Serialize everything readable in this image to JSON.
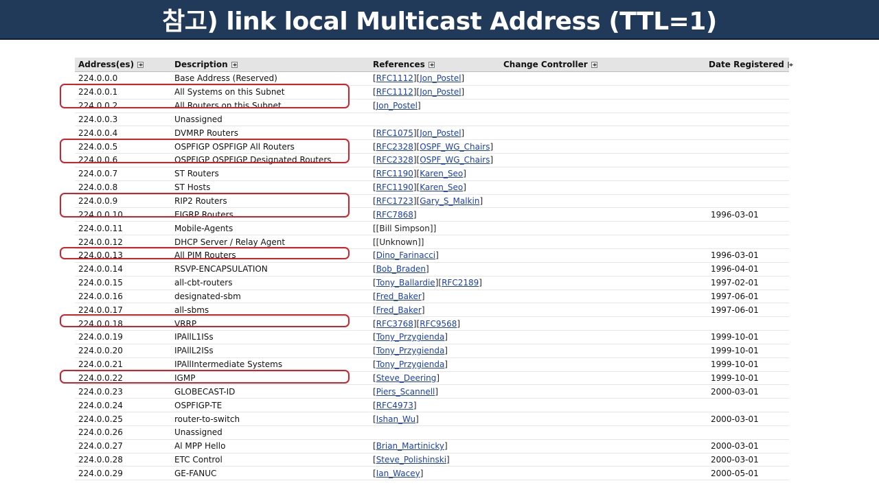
{
  "banner": {
    "title": "참고) link local Multicast Address (TTL=1)"
  },
  "table": {
    "headers": {
      "address": "Address(es)",
      "description": "Description",
      "references": "References",
      "change_controller": "Change Controller",
      "date_registered": "Date Registered"
    },
    "rows": [
      {
        "address": "224.0.0.0",
        "description": "Base Address (Reserved)",
        "refs": [
          {
            "t": "RFC1112",
            "link": true
          },
          {
            "t": "Jon_Postel",
            "link": true
          }
        ],
        "date": ""
      },
      {
        "address": "224.0.0.1",
        "description": "All Systems on this Subnet",
        "refs": [
          {
            "t": "RFC1112",
            "link": true
          },
          {
            "t": "Jon_Postel",
            "link": true
          }
        ],
        "date": ""
      },
      {
        "address": "224.0.0.2",
        "description": "All Routers on this Subnet",
        "refs": [
          {
            "t": "Jon_Postel",
            "link": true
          }
        ],
        "date": ""
      },
      {
        "address": "224.0.0.3",
        "description": "Unassigned",
        "refs": [],
        "date": ""
      },
      {
        "address": "224.0.0.4",
        "description": "DVMRP Routers",
        "refs": [
          {
            "t": "RFC1075",
            "link": true
          },
          {
            "t": "Jon_Postel",
            "link": true
          }
        ],
        "date": ""
      },
      {
        "address": "224.0.0.5",
        "description": "OSPFIGP OSPFIGP All Routers",
        "refs": [
          {
            "t": "RFC2328",
            "link": true
          },
          {
            "t": "OSPF_WG_Chairs",
            "link": true
          }
        ],
        "date": ""
      },
      {
        "address": "224.0.0.6",
        "description": "OSPFIGP OSPFIGP Designated Routers",
        "refs": [
          {
            "t": "RFC2328",
            "link": true
          },
          {
            "t": "OSPF_WG_Chairs",
            "link": true
          }
        ],
        "date": ""
      },
      {
        "address": "224.0.0.7",
        "description": "ST Routers",
        "refs": [
          {
            "t": "RFC1190",
            "link": true
          },
          {
            "t": "Karen_Seo",
            "link": true
          }
        ],
        "date": ""
      },
      {
        "address": "224.0.0.8",
        "description": "ST Hosts",
        "refs": [
          {
            "t": "RFC1190",
            "link": true
          },
          {
            "t": "Karen_Seo",
            "link": true
          }
        ],
        "date": ""
      },
      {
        "address": "224.0.0.9",
        "description": "RIP2 Routers",
        "refs": [
          {
            "t": "RFC1723",
            "link": true
          },
          {
            "t": "Gary_S_Malkin",
            "link": true
          }
        ],
        "date": ""
      },
      {
        "address": "224.0.0.10",
        "description": "EIGRP Routers",
        "refs": [
          {
            "t": "RFC7868",
            "link": true
          }
        ],
        "date": "1996-03-01"
      },
      {
        "address": "224.0.0.11",
        "description": "Mobile-Agents",
        "refs": [
          {
            "t": "Bill Simpson",
            "link": false
          }
        ],
        "date": ""
      },
      {
        "address": "224.0.0.12",
        "description": "DHCP Server / Relay Agent",
        "refs": [
          {
            "t": "Unknown",
            "link": false
          }
        ],
        "date": ""
      },
      {
        "address": "224.0.0.13",
        "description": "All PIM Routers",
        "refs": [
          {
            "t": "Dino_Farinacci",
            "link": true
          }
        ],
        "date": "1996-03-01"
      },
      {
        "address": "224.0.0.14",
        "description": "RSVP-ENCAPSULATION",
        "refs": [
          {
            "t": "Bob_Braden",
            "link": true
          }
        ],
        "date": "1996-04-01"
      },
      {
        "address": "224.0.0.15",
        "description": "all-cbt-routers",
        "refs": [
          {
            "t": "Tony_Ballardie",
            "link": true
          },
          {
            "t": "RFC2189",
            "link": true
          }
        ],
        "date": "1997-02-01"
      },
      {
        "address": "224.0.0.16",
        "description": "designated-sbm",
        "refs": [
          {
            "t": "Fred_Baker",
            "link": true
          }
        ],
        "date": "1997-06-01"
      },
      {
        "address": "224.0.0.17",
        "description": "all-sbms",
        "refs": [
          {
            "t": "Fred_Baker",
            "link": true
          }
        ],
        "date": "1997-06-01"
      },
      {
        "address": "224.0.0.18",
        "description": "VRRP",
        "refs": [
          {
            "t": "RFC3768",
            "link": true
          },
          {
            "t": "RFC9568",
            "link": true
          }
        ],
        "date": ""
      },
      {
        "address": "224.0.0.19",
        "description": "IPAllL1ISs",
        "refs": [
          {
            "t": "Tony_Przygienda",
            "link": true
          }
        ],
        "date": "1999-10-01"
      },
      {
        "address": "224.0.0.20",
        "description": "IPAllL2ISs",
        "refs": [
          {
            "t": "Tony_Przygienda",
            "link": true
          }
        ],
        "date": "1999-10-01"
      },
      {
        "address": "224.0.0.21",
        "description": "IPAllIntermediate Systems",
        "refs": [
          {
            "t": "Tony_Przygienda",
            "link": true
          }
        ],
        "date": "1999-10-01"
      },
      {
        "address": "224.0.0.22",
        "description": "IGMP",
        "refs": [
          {
            "t": "Steve_Deering",
            "link": true
          }
        ],
        "date": "1999-10-01"
      },
      {
        "address": "224.0.0.23",
        "description": "GLOBECAST-ID",
        "refs": [
          {
            "t": "Piers_Scannell",
            "link": true
          }
        ],
        "date": "2000-03-01"
      },
      {
        "address": "224.0.0.24",
        "description": "OSPFIGP-TE",
        "refs": [
          {
            "t": "RFC4973",
            "link": true
          }
        ],
        "date": ""
      },
      {
        "address": "224.0.0.25",
        "description": "router-to-switch",
        "refs": [
          {
            "t": "Ishan_Wu",
            "link": true
          }
        ],
        "date": "2000-03-01"
      },
      {
        "address": "224.0.0.26",
        "description": "Unassigned",
        "refs": [],
        "date": ""
      },
      {
        "address": "224.0.0.27",
        "description": "Al MPP Hello",
        "refs": [
          {
            "t": "Brian_Martinicky",
            "link": true
          }
        ],
        "date": "2000-03-01"
      },
      {
        "address": "224.0.0.28",
        "description": "ETC Control",
        "refs": [
          {
            "t": "Steve_Polishinski",
            "link": true
          }
        ],
        "date": "2000-03-01"
      },
      {
        "address": "224.0.0.29",
        "description": "GE-FANUC",
        "refs": [
          {
            "t": "Ian_Wacey",
            "link": true
          }
        ],
        "date": "2000-05-01"
      }
    ]
  },
  "highlight_colors": {
    "box": "#d0202a"
  },
  "link_color": "#1a3fb0"
}
